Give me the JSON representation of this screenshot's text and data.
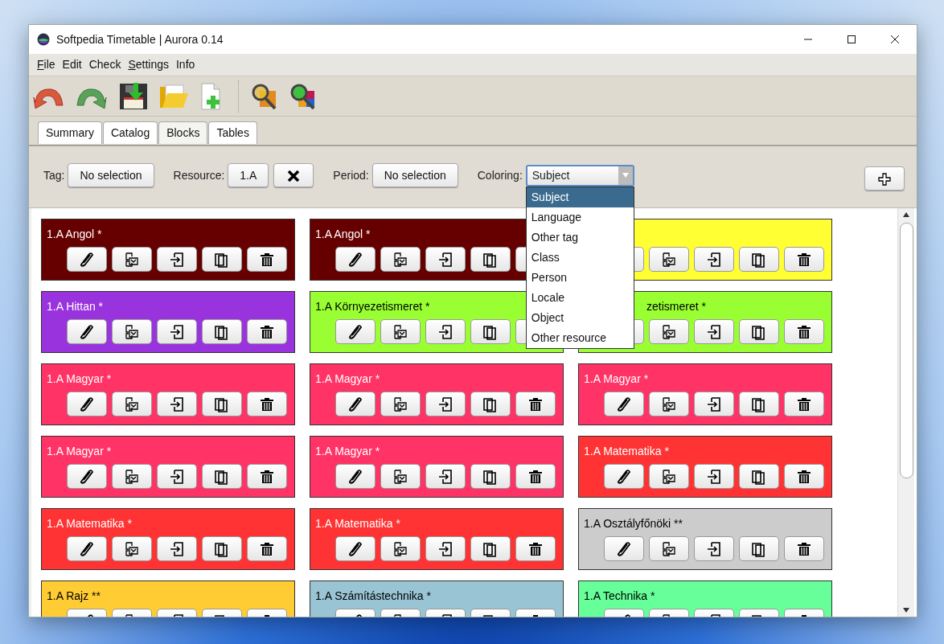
{
  "window": {
    "title": "Softpedia Timetable | Aurora 0.14"
  },
  "menu": [
    {
      "label": "File",
      "underlined_first": true
    },
    {
      "label": "Edit",
      "underlined_first": false
    },
    {
      "label": "Check",
      "underlined_first": false
    },
    {
      "label": "Settings",
      "underlined_first": true
    },
    {
      "label": "Info",
      "underlined_first": false
    }
  ],
  "tabs": [
    {
      "label": "Summary",
      "selected": false
    },
    {
      "label": "Catalog",
      "selected": false
    },
    {
      "label": "Blocks",
      "selected": true
    },
    {
      "label": "Tables",
      "selected": false
    }
  ],
  "filters": [
    {
      "label": "Tag:",
      "value": "No selection",
      "clearable": false
    },
    {
      "label": "Resource:",
      "value": "1.A",
      "clearable": true
    },
    {
      "label": "Period:",
      "value": "No selection",
      "clearable": false
    }
  ],
  "coloring": {
    "label": "Coloring:",
    "value": "Subject",
    "expanded": true,
    "options": [
      {
        "label": "Subject",
        "selected": true
      },
      {
        "label": "Language",
        "selected": false
      },
      {
        "label": "Other tag",
        "selected": false
      },
      {
        "label": "Class",
        "selected": false
      },
      {
        "label": "Person",
        "selected": false
      },
      {
        "label": "Locale",
        "selected": false
      },
      {
        "label": "Object",
        "selected": false
      },
      {
        "label": "Other resource",
        "selected": false
      }
    ]
  },
  "blocks": [
    {
      "title": "1.A Angol *",
      "color": "#660000"
    },
    {
      "title": "1.A Angol *",
      "color": "#660000"
    },
    {
      "color": "#ffff33"
    },
    {
      "title": "1.A Hittan *",
      "color": "#9933dd"
    },
    {
      "title": "1.A Környezetismeret *",
      "color": "#99ff33"
    },
    {
      "title": "zetismeret *",
      "color": "#99ff33",
      "covered": true
    },
    {
      "title": "1.A Magyar *",
      "color": "#ff3366"
    },
    {
      "title": "1.A Magyar *",
      "color": "#ff3366"
    },
    {
      "title": "1.A Magyar *",
      "color": "#ff3366"
    },
    {
      "title": "1.A Magyar *",
      "color": "#ff3366"
    },
    {
      "title": "1.A Magyar *",
      "color": "#ff3366"
    },
    {
      "title": "1.A Matematika *",
      "color": "#ff3333"
    },
    {
      "title": "1.A Matematika *",
      "color": "#ff3333"
    },
    {
      "title": "1.A Matematika *",
      "color": "#ff3333"
    },
    {
      "title": "1.A Osztályfőnöki **",
      "color": "#cccccc"
    },
    {
      "title": "1.A Rajz **",
      "color": "#ffcc33"
    },
    {
      "title": "1.A Számítástechnika *",
      "color": "#99c4d4"
    },
    {
      "title": "1.A Technika *",
      "color": "#66ff99"
    }
  ]
}
